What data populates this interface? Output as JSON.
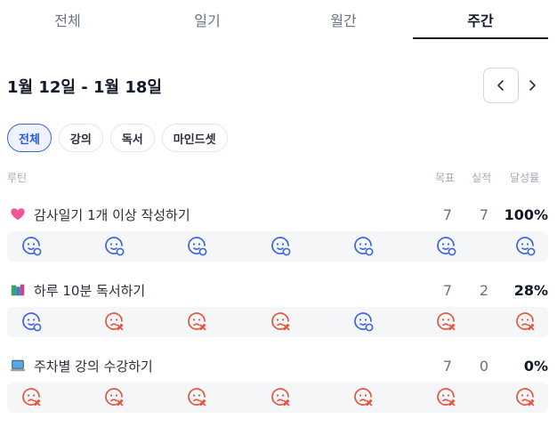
{
  "tabs": [
    "전체",
    "일기",
    "월간",
    "주간"
  ],
  "active_tab": 3,
  "date_range": "1월 12일 - 1월 18일",
  "filters": [
    "전체",
    "강의",
    "독서",
    "마인드셋"
  ],
  "active_filter": 0,
  "columns": {
    "routine": "루틴",
    "goal": "목표",
    "actual": "실적",
    "rate": "달성률"
  },
  "routines": [
    {
      "emoji": "heart-icon",
      "title": "감사일기 1개 이상 작성하기",
      "goal": "7",
      "actual": "7",
      "rate": "100%",
      "days": [
        "done",
        "done",
        "done",
        "done",
        "done",
        "done",
        "done"
      ]
    },
    {
      "emoji": "books-icon",
      "title": "하루 10분 독서하기",
      "goal": "7",
      "actual": "2",
      "rate": "28%",
      "days": [
        "done",
        "missed",
        "missed",
        "missed",
        "done",
        "missed",
        "missed"
      ]
    },
    {
      "emoji": "laptop-icon",
      "title": "주차별 강의 수강하기",
      "goal": "7",
      "actual": "0",
      "rate": "0%",
      "days": [
        "missed",
        "missed",
        "missed",
        "missed",
        "missed",
        "missed",
        "missed"
      ]
    }
  ],
  "colors": {
    "done": "#3b63e6",
    "missed": "#e8553f",
    "accent": "#3b63e6"
  }
}
